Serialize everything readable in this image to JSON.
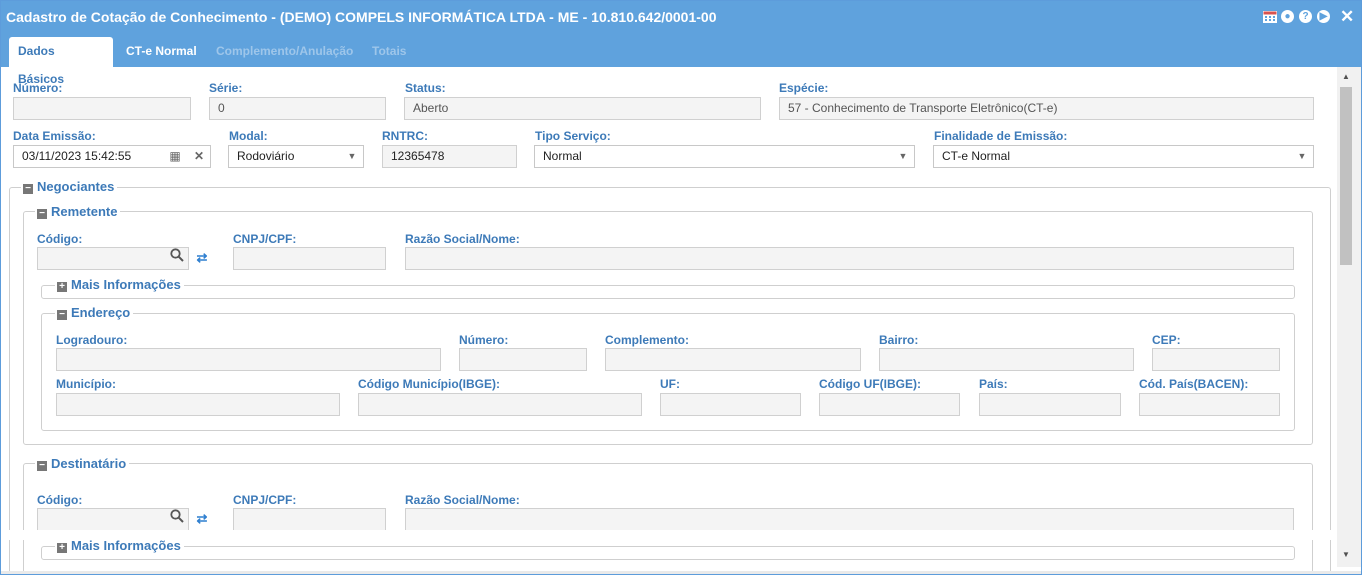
{
  "window": {
    "title": "Cadastro de Cotação de Conhecimento - (DEMO) COMPELS INFORMÁTICA LTDA - ME - 10.810.642/0001-00",
    "icons": [
      "calendar-icon",
      "circle-icon",
      "help-icon",
      "play-icon",
      "close-icon"
    ]
  },
  "tabs": [
    {
      "label": "Dados Básicos",
      "state": "active"
    },
    {
      "label": "CT-e Normal",
      "state": "enabled"
    },
    {
      "label": "Complemento/Anulação",
      "state": "disabled"
    },
    {
      "label": "Totais",
      "state": "disabled"
    }
  ],
  "basic": {
    "numero": {
      "label": "Número:",
      "value": ""
    },
    "serie": {
      "label": "Série:",
      "value": "0"
    },
    "status": {
      "label": "Status:",
      "value": "Aberto"
    },
    "especie": {
      "label": "Espécie:",
      "value": "57 - Conhecimento de Transporte Eletrônico(CT-e)"
    },
    "data_emissao": {
      "label": "Data Emissão:",
      "value": "03/11/2023 15:42:55"
    },
    "modal": {
      "label": "Modal:",
      "value": "Rodoviário"
    },
    "rntrc": {
      "label": "RNTRC:",
      "value": "12365478"
    },
    "tipo_servico": {
      "label": "Tipo Serviço:",
      "value": "Normal"
    },
    "finalidade": {
      "label": "Finalidade de Emissão:",
      "value": "CT-e Normal"
    }
  },
  "negociantes": {
    "legend": "Negociantes",
    "remetente": {
      "legend": "Remetente",
      "codigo_label": "Código:",
      "codigo_value": "",
      "cnpj_label": "CNPJ/CPF:",
      "cnpj_value": "",
      "razao_label": "Razão Social/Nome:",
      "razao_value": "",
      "mais_info": "Mais Informações",
      "endereco": {
        "legend": "Endereço",
        "logradouro": "Logradouro:",
        "numero": "Número:",
        "complemento": "Complemento:",
        "bairro": "Bairro:",
        "cep": "CEP:",
        "municipio": "Município:",
        "cod_municipio": "Código Município(IBGE):",
        "uf": "UF:",
        "cod_uf": "Código UF(IBGE):",
        "pais": "País:",
        "cod_pais": "Cód. País(BACEN):"
      }
    },
    "destinatario": {
      "legend": "Destinatário",
      "codigo_label": "Código:",
      "codigo_value": "",
      "cnpj_label": "CNPJ/CPF:",
      "cnpj_value": "",
      "razao_label": "Razão Social/Nome:",
      "razao_value": "",
      "mais_info": "Mais Informações"
    }
  },
  "colors": {
    "accent": "#5fa2dd",
    "label": "#3d7ab8"
  }
}
